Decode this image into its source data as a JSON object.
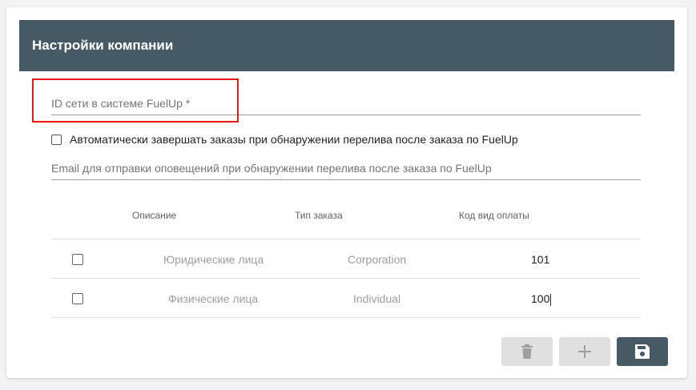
{
  "header": {
    "title": "Настройки компании"
  },
  "fields": {
    "network_id": {
      "placeholder": "ID сети в системе FuelUp *",
      "value": ""
    },
    "auto_complete": {
      "label": "Автоматически завершать заказы при обнаружении перелива после заказа по FuelUp",
      "checked": false
    },
    "email": {
      "placeholder": "Email для отправки оповещений при обнаружении перелива после заказа по FuelUp",
      "value": ""
    }
  },
  "table": {
    "columns": [
      "Описание",
      "Тип заказа",
      "Код вид оплаты"
    ],
    "rows": [
      {
        "description": "Юридические лица",
        "order_type": "Corporation",
        "payment_code": "101",
        "checked": false
      },
      {
        "description": "Физические лица",
        "order_type": "Individual",
        "payment_code": "100",
        "checked": false
      }
    ]
  },
  "buttons": {
    "delete": {
      "icon": "trash-icon",
      "enabled": false
    },
    "add": {
      "icon": "plus-icon",
      "enabled": false
    },
    "save": {
      "icon": "floppy-disk-icon",
      "enabled": true
    }
  },
  "colors": {
    "header_bg": "#455a64",
    "highlight": "#e81919"
  }
}
